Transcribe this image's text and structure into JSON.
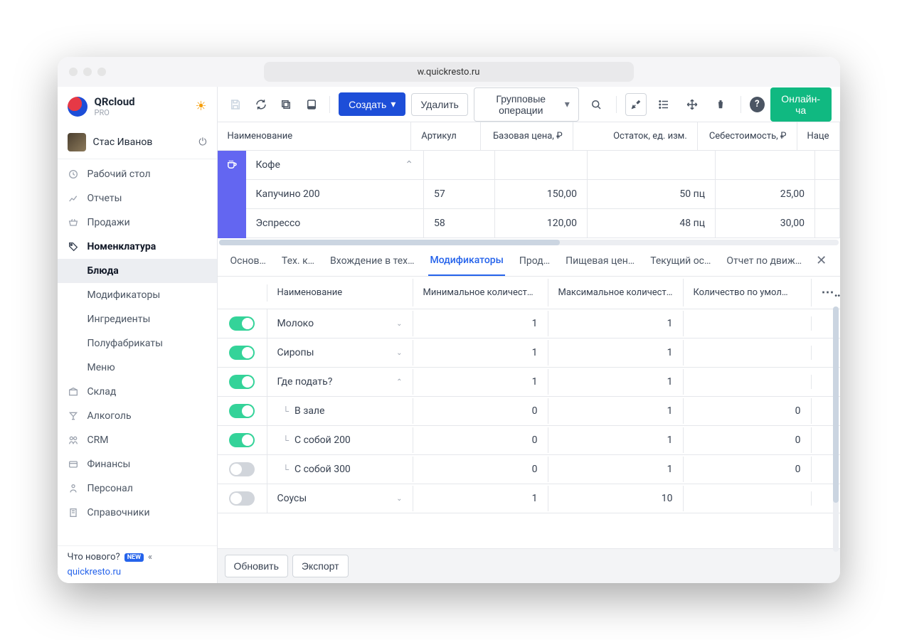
{
  "browser": {
    "url": "w.quickresto.ru"
  },
  "app": {
    "name": "QRcloud",
    "plan": "PRO"
  },
  "user": {
    "name": "Стас Иванов"
  },
  "sidebar": {
    "items": [
      {
        "label": "Рабочий стол",
        "icon": "dashboard-icon"
      },
      {
        "label": "Отчеты",
        "icon": "chart-icon"
      },
      {
        "label": "Продажи",
        "icon": "basket-icon"
      },
      {
        "label": "Номенклатура",
        "icon": "tag-icon",
        "active": true,
        "children": [
          {
            "label": "Блюда",
            "active": true
          },
          {
            "label": "Модификаторы"
          },
          {
            "label": "Ингредиенты"
          },
          {
            "label": "Полуфабрикаты"
          },
          {
            "label": "Меню"
          }
        ]
      },
      {
        "label": "Склад",
        "icon": "stock-icon"
      },
      {
        "label": "Алкоголь",
        "icon": "martini-icon"
      },
      {
        "label": "CRM",
        "icon": "crm-icon"
      },
      {
        "label": "Финансы",
        "icon": "finance-icon"
      },
      {
        "label": "Персонал",
        "icon": "staff-icon"
      },
      {
        "label": "Справочники",
        "icon": "book-icon"
      }
    ],
    "whats_new": "Что нового?",
    "new_badge": "NEW",
    "site_link": "quickresto.ru"
  },
  "toolbar": {
    "create": "Создать",
    "delete": "Удалить",
    "group_ops": "Групповые операции",
    "online_chat": "Онлайн-ча"
  },
  "top_table": {
    "headers": [
      "Наименование",
      "Артикул",
      "Базовая цена, ₽",
      "Остаток, ед. изм.",
      "Себестоимость, ₽",
      "Наце"
    ],
    "category": "Кофе",
    "rows": [
      {
        "name": "Капучино 200",
        "sku": "57",
        "price": "150,00",
        "stock": "50 пц",
        "cost": "25,00"
      },
      {
        "name": "Эспрессо",
        "sku": "58",
        "price": "120,00",
        "stock": "48 пц",
        "cost": "30,00"
      }
    ]
  },
  "tabs": {
    "items": [
      "Основ…",
      "Тех. к…",
      "Вхождение в тех…",
      "Модификаторы",
      "Прод…",
      "Пищевая цен…",
      "Текущий ос…",
      "Отчет по движ…"
    ],
    "active_index": 3
  },
  "modifiers": {
    "headers": [
      "Наименование",
      "Минимальное количество",
      "Максимальное количество",
      "Количество по умол…"
    ],
    "rows": [
      {
        "name": "Молоко",
        "on": true,
        "expand": "down",
        "min": "1",
        "max": "1",
        "def": ""
      },
      {
        "name": "Сиропы",
        "on": true,
        "expand": "down",
        "min": "1",
        "max": "1",
        "def": ""
      },
      {
        "name": "Где подать?",
        "on": true,
        "expand": "up",
        "min": "1",
        "max": "1",
        "def": ""
      },
      {
        "name": "В зале",
        "on": true,
        "child": true,
        "min": "0",
        "max": "1",
        "def": "0"
      },
      {
        "name": "С собой 200",
        "on": true,
        "child": true,
        "min": "0",
        "max": "1",
        "def": "0"
      },
      {
        "name": "С собой 300",
        "on": false,
        "child": true,
        "min": "0",
        "max": "1",
        "def": "0"
      },
      {
        "name": "Соусы",
        "on": false,
        "expand": "down",
        "min": "1",
        "max": "10",
        "def": ""
      }
    ]
  },
  "bottom": {
    "refresh": "Обновить",
    "export": "Экспорт"
  }
}
